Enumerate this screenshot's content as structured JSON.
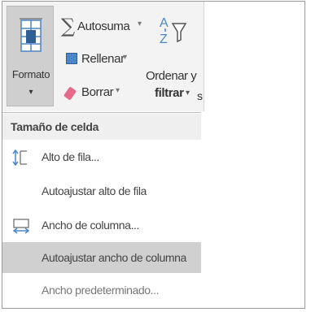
{
  "ribbon": {
    "formato_label": "Formato",
    "formato_caret": "▾",
    "autosuma_label": "Autosuma",
    "rellenar_label": "Rellenar",
    "borrar_label": "Borrar",
    "ordenar_line1": "Ordenar y",
    "ordenar_line2": "filtrar",
    "truncated_label": "s",
    "dropdown_arrow": "▾",
    "sigma": "∑"
  },
  "menu": {
    "section_header": "Tamaño de celda",
    "items": [
      {
        "label": "Alto de fila...",
        "icon": "row-height-icon"
      },
      {
        "label": "Autoajustar alto de fila",
        "icon": ""
      },
      {
        "label": "Ancho de columna...",
        "icon": "column-width-icon"
      },
      {
        "label": "Autoajustar ancho de columna",
        "icon": ""
      },
      {
        "label": "Ancho predeterminado...",
        "icon": ""
      }
    ]
  },
  "colors": {
    "highlight": "#d0d0d0",
    "ribbon_bg": "#f3f3f3",
    "pressed_button": "#cfcfcf",
    "accent_blue": "#4a86c7",
    "eraser_pink": "#e66a8a"
  }
}
